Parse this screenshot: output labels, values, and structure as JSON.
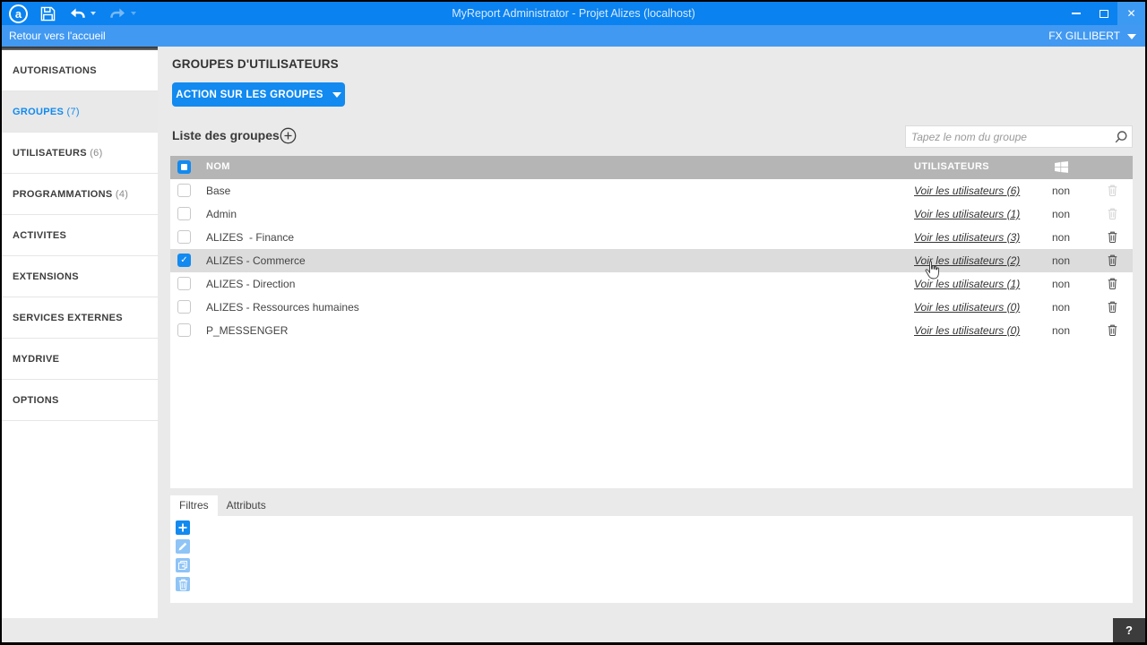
{
  "window": {
    "title": "MyReport Administrator - Projet Alizes (localhost)",
    "controls": [
      "minimize",
      "maximize",
      "close"
    ]
  },
  "toolbar": {
    "icons": [
      "myreport-logo",
      "save",
      "undo",
      "redo"
    ]
  },
  "navbar": {
    "back_label": "Retour vers l'accueil",
    "user": "FX GILLIBERT"
  },
  "sidebar": {
    "items": [
      {
        "label": "AUTORISATIONS",
        "count": "",
        "active": false
      },
      {
        "label": "GROUPES",
        "count": "(7)",
        "active": true
      },
      {
        "label": "UTILISATEURS",
        "count": "(6)",
        "active": false
      },
      {
        "label": "PROGRAMMATIONS",
        "count": "(4)",
        "active": false
      },
      {
        "label": "ACTIVITES",
        "count": "",
        "active": false
      },
      {
        "label": "EXTENSIONS",
        "count": "",
        "active": false
      },
      {
        "label": "SERVICES EXTERNES",
        "count": "",
        "active": false
      },
      {
        "label": "MYDRIVE",
        "count": "",
        "active": false
      },
      {
        "label": "OPTIONS",
        "count": "",
        "active": false
      }
    ]
  },
  "main": {
    "page_title": "GROUPES D'UTILISATEURS",
    "action_button": "ACTION SUR LES GROUPES",
    "list_title": "Liste des groupes",
    "search_placeholder": "Tapez le nom du groupe",
    "table": {
      "columns": {
        "name": "NOM",
        "users": "UTILISATEURS",
        "windows_auth_icon": "windows-logo-icon"
      },
      "rows": [
        {
          "name": "Base",
          "users_link": "Voir les utilisateurs (6)",
          "windows_auth": "non",
          "deletable": false,
          "checked": false,
          "selected": false
        },
        {
          "name": "Admin",
          "users_link": "Voir les utilisateurs (1)",
          "windows_auth": "non",
          "deletable": false,
          "checked": false,
          "selected": false
        },
        {
          "name": "ALIZES  - Finance",
          "users_link": "Voir les utilisateurs (3)",
          "windows_auth": "non",
          "deletable": true,
          "checked": false,
          "selected": false
        },
        {
          "name": "ALIZES - Commerce",
          "users_link": "Voir les utilisateurs (2)",
          "windows_auth": "non",
          "deletable": true,
          "checked": true,
          "selected": true
        },
        {
          "name": "ALIZES - Direction",
          "users_link": "Voir les utilisateurs (1)",
          "windows_auth": "non",
          "deletable": true,
          "checked": false,
          "selected": false
        },
        {
          "name": "ALIZES - Ressources humaines",
          "users_link": "Voir les utilisateurs (0)",
          "windows_auth": "non",
          "deletable": true,
          "checked": false,
          "selected": false
        },
        {
          "name": "P_MESSENGER",
          "users_link": "Voir les utilisateurs (0)",
          "windows_auth": "non",
          "deletable": true,
          "checked": false,
          "selected": false
        }
      ]
    },
    "tabs": [
      {
        "label": "Filtres",
        "active": true
      },
      {
        "label": "Attributs",
        "active": false
      }
    ],
    "filter_toolbar": {
      "icons": [
        "add-icon",
        "edit-icon",
        "duplicate-icon",
        "delete-icon"
      ]
    }
  },
  "help": {
    "label": "?"
  },
  "colors": {
    "titlebar": "#0a82f0",
    "navbar": "#4199f2",
    "accent": "#128af0",
    "table_header": "#b5b5b5",
    "selected_row": "#dcdcdc",
    "page_bg": "#eaeaea",
    "help_bg": "#3c3c3c",
    "link_text": "#333333"
  }
}
